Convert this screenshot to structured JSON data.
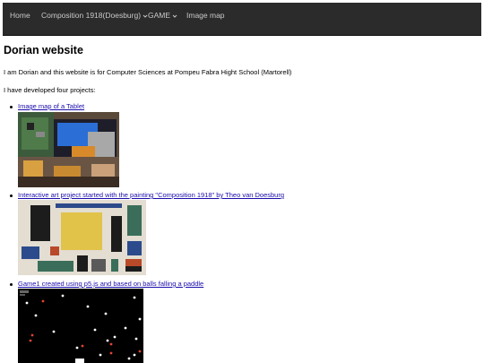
{
  "nav": {
    "home": "Home",
    "composition": "Composition 1918(Doesburg)",
    "game": "GAME",
    "image_map": "Image map"
  },
  "page": {
    "title": "Dorian website",
    "intro": "I am Dorian and this website is for Computer Sciences at Pompeu Fabra Hight School (Martorell)",
    "projects_intro": "I have developed four projects:"
  },
  "projects": [
    {
      "label": "Image map of a Tablet",
      "image": "tablet-circuit-photo"
    },
    {
      "label": "Interactive art project started with the painting \"Composition 1918\" by Theo van Doesburg",
      "image": "composition-1918-painting"
    },
    {
      "label": "Game1 created using p5.js and based on balls falling a paddle",
      "image": "game-canvas-screenshot"
    }
  ],
  "colors": {
    "navbar": "#2b2b2b",
    "nav_text": "#c9c9c9",
    "link": "#1a0dab"
  }
}
